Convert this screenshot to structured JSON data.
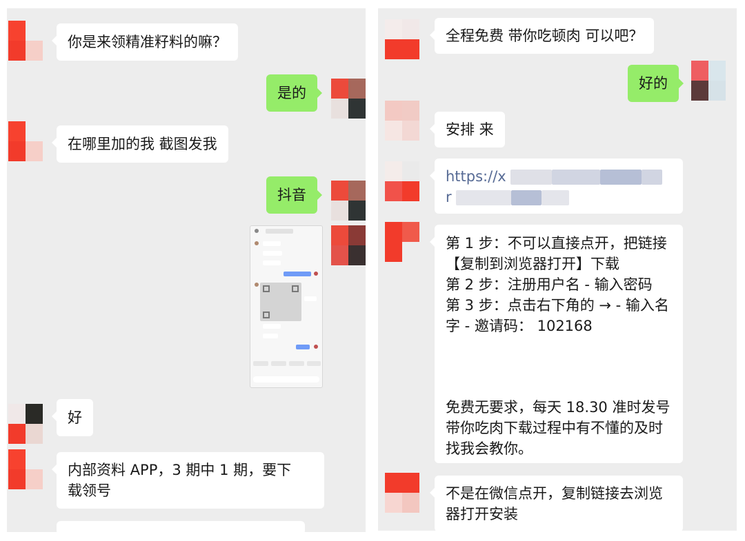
{
  "left_panel": {
    "messages": [
      {
        "from": "contact",
        "text": "你是来领精准籽料的嘛？"
      },
      {
        "from": "me",
        "text": "是的"
      },
      {
        "from": "contact",
        "text": "在哪里加的我  截图发我"
      },
      {
        "from": "me",
        "text": "抖音"
      },
      {
        "from": "me",
        "type": "image",
        "description": "chat screenshot"
      },
      {
        "from": "contact",
        "text": "好"
      },
      {
        "from": "contact",
        "line1": "内部资料 APP，3 期中 1 期，要下",
        "line2": "载领号"
      }
    ]
  },
  "right_panel": {
    "messages": [
      {
        "from": "contact",
        "text": "全程免费  带你吃顿肉  可以吧？"
      },
      {
        "from": "me",
        "text": "好的"
      },
      {
        "from": "contact",
        "text": "安排 来"
      },
      {
        "from": "contact",
        "type": "link",
        "line1": "https://x",
        "line2": "r"
      },
      {
        "from": "contact",
        "lines": [
          "第 1 步：不可以直接点开，把链接",
          "【复制到浏览器打开】下载",
          "第 2 步：注册用户名 - 输入密码",
          "第 3 步：点击右下角的 → - 输入名",
          "字 - 邀请码：  102168",
          "",
          "",
          "",
          "免费无要求，每天 18.30 准时发号",
          "带你吃肉下载过程中有不懂的及时",
          "找我会教你。"
        ]
      },
      {
        "from": "contact",
        "line1": "不是在微信点开，复制链接去浏览",
        "line2": "器打开安装"
      }
    ]
  },
  "colors": {
    "background": "#ededed",
    "incoming_bubble": "#ffffff",
    "outgoing_bubble": "#95ec69",
    "link": "#576b95",
    "avatar_red": "#f23b2b"
  }
}
